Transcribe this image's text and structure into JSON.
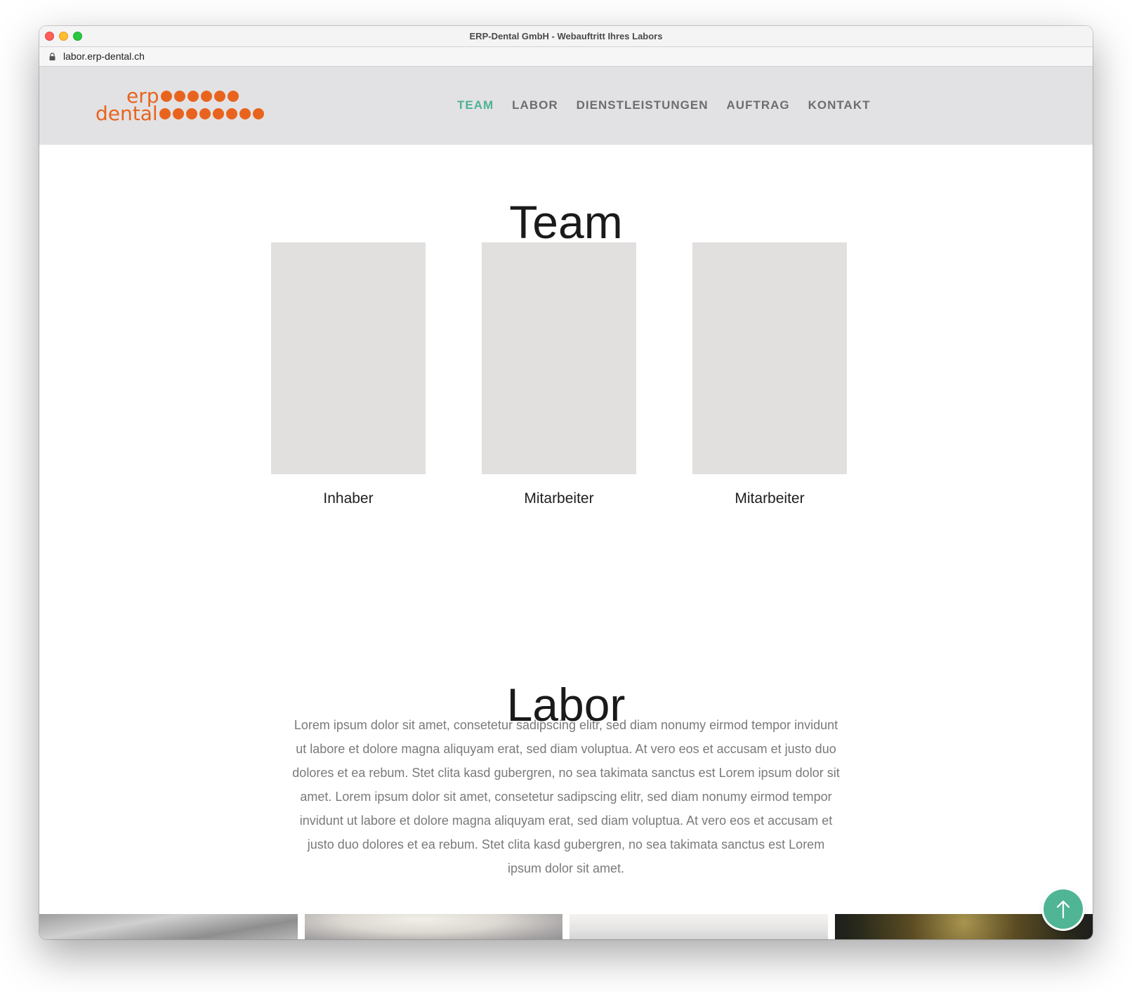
{
  "window": {
    "title": "ERP-Dental GmbH - Webauftritt Ihres Labors"
  },
  "browser": {
    "url": "labor.erp-dental.ch"
  },
  "logo": {
    "line1": "erp",
    "line2": "dental",
    "dots_line1": 6,
    "dots_line2": 8,
    "color": "#e8641e"
  },
  "nav": {
    "items": [
      {
        "label": "TEAM",
        "active": true
      },
      {
        "label": "LABOR",
        "active": false
      },
      {
        "label": "DIENSTLEISTUNGEN",
        "active": false
      },
      {
        "label": "AUFTRAG",
        "active": false
      },
      {
        "label": "KONTAKT",
        "active": false
      }
    ],
    "active_color": "#4fb095"
  },
  "team": {
    "title": "Team",
    "members": [
      {
        "role": "Inhaber"
      },
      {
        "role": "Mitarbeiter"
      },
      {
        "role": "Mitarbeiter"
      }
    ]
  },
  "labor": {
    "title": "Labor",
    "text": "Lorem ipsum dolor sit amet, consetetur sadipscing elitr, sed diam nonumy eirmod tempor invidunt ut labore et dolore magna aliquyam erat, sed diam voluptua. At vero eos et accusam et justo duo dolores et ea rebum. Stet clita kasd gubergren, no sea takimata sanctus est Lorem ipsum dolor sit amet. Lorem ipsum dolor sit amet, consetetur sadipscing elitr, sed diam nonumy eirmod tempor invidunt ut labore et dolore magna aliquyam erat, sed diam voluptua. At vero eos et accusam et justo duo dolores et ea rebum. Stet clita kasd gubergren, no sea takimata sanctus est Lorem ipsum dolor sit amet."
  },
  "scroll_top": {
    "icon": "arrow-up-icon",
    "color": "#4fb595"
  }
}
